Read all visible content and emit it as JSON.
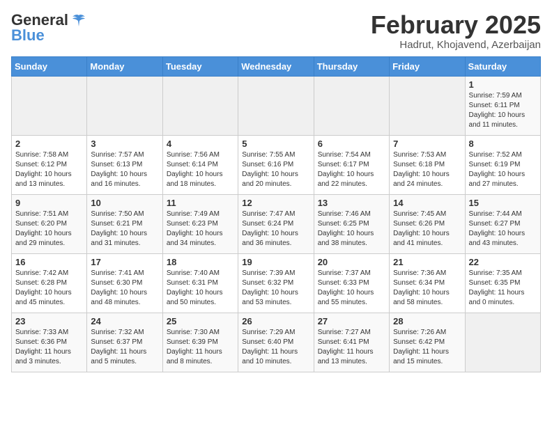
{
  "header": {
    "logo_general": "General",
    "logo_blue": "Blue",
    "month_title": "February 2025",
    "location": "Hadrut, Khojavend, Azerbaijan"
  },
  "weekdays": [
    "Sunday",
    "Monday",
    "Tuesday",
    "Wednesday",
    "Thursday",
    "Friday",
    "Saturday"
  ],
  "weeks": [
    [
      {
        "day": "",
        "info": ""
      },
      {
        "day": "",
        "info": ""
      },
      {
        "day": "",
        "info": ""
      },
      {
        "day": "",
        "info": ""
      },
      {
        "day": "",
        "info": ""
      },
      {
        "day": "",
        "info": ""
      },
      {
        "day": "1",
        "info": "Sunrise: 7:59 AM\nSunset: 6:11 PM\nDaylight: 10 hours\nand 11 minutes."
      }
    ],
    [
      {
        "day": "2",
        "info": "Sunrise: 7:58 AM\nSunset: 6:12 PM\nDaylight: 10 hours\nand 13 minutes."
      },
      {
        "day": "3",
        "info": "Sunrise: 7:57 AM\nSunset: 6:13 PM\nDaylight: 10 hours\nand 16 minutes."
      },
      {
        "day": "4",
        "info": "Sunrise: 7:56 AM\nSunset: 6:14 PM\nDaylight: 10 hours\nand 18 minutes."
      },
      {
        "day": "5",
        "info": "Sunrise: 7:55 AM\nSunset: 6:16 PM\nDaylight: 10 hours\nand 20 minutes."
      },
      {
        "day": "6",
        "info": "Sunrise: 7:54 AM\nSunset: 6:17 PM\nDaylight: 10 hours\nand 22 minutes."
      },
      {
        "day": "7",
        "info": "Sunrise: 7:53 AM\nSunset: 6:18 PM\nDaylight: 10 hours\nand 24 minutes."
      },
      {
        "day": "8",
        "info": "Sunrise: 7:52 AM\nSunset: 6:19 PM\nDaylight: 10 hours\nand 27 minutes."
      }
    ],
    [
      {
        "day": "9",
        "info": "Sunrise: 7:51 AM\nSunset: 6:20 PM\nDaylight: 10 hours\nand 29 minutes."
      },
      {
        "day": "10",
        "info": "Sunrise: 7:50 AM\nSunset: 6:21 PM\nDaylight: 10 hours\nand 31 minutes."
      },
      {
        "day": "11",
        "info": "Sunrise: 7:49 AM\nSunset: 6:23 PM\nDaylight: 10 hours\nand 34 minutes."
      },
      {
        "day": "12",
        "info": "Sunrise: 7:47 AM\nSunset: 6:24 PM\nDaylight: 10 hours\nand 36 minutes."
      },
      {
        "day": "13",
        "info": "Sunrise: 7:46 AM\nSunset: 6:25 PM\nDaylight: 10 hours\nand 38 minutes."
      },
      {
        "day": "14",
        "info": "Sunrise: 7:45 AM\nSunset: 6:26 PM\nDaylight: 10 hours\nand 41 minutes."
      },
      {
        "day": "15",
        "info": "Sunrise: 7:44 AM\nSunset: 6:27 PM\nDaylight: 10 hours\nand 43 minutes."
      }
    ],
    [
      {
        "day": "16",
        "info": "Sunrise: 7:42 AM\nSunset: 6:28 PM\nDaylight: 10 hours\nand 45 minutes."
      },
      {
        "day": "17",
        "info": "Sunrise: 7:41 AM\nSunset: 6:30 PM\nDaylight: 10 hours\nand 48 minutes."
      },
      {
        "day": "18",
        "info": "Sunrise: 7:40 AM\nSunset: 6:31 PM\nDaylight: 10 hours\nand 50 minutes."
      },
      {
        "day": "19",
        "info": "Sunrise: 7:39 AM\nSunset: 6:32 PM\nDaylight: 10 hours\nand 53 minutes."
      },
      {
        "day": "20",
        "info": "Sunrise: 7:37 AM\nSunset: 6:33 PM\nDaylight: 10 hours\nand 55 minutes."
      },
      {
        "day": "21",
        "info": "Sunrise: 7:36 AM\nSunset: 6:34 PM\nDaylight: 10 hours\nand 58 minutes."
      },
      {
        "day": "22",
        "info": "Sunrise: 7:35 AM\nSunset: 6:35 PM\nDaylight: 11 hours\nand 0 minutes."
      }
    ],
    [
      {
        "day": "23",
        "info": "Sunrise: 7:33 AM\nSunset: 6:36 PM\nDaylight: 11 hours\nand 3 minutes."
      },
      {
        "day": "24",
        "info": "Sunrise: 7:32 AM\nSunset: 6:37 PM\nDaylight: 11 hours\nand 5 minutes."
      },
      {
        "day": "25",
        "info": "Sunrise: 7:30 AM\nSunset: 6:39 PM\nDaylight: 11 hours\nand 8 minutes."
      },
      {
        "day": "26",
        "info": "Sunrise: 7:29 AM\nSunset: 6:40 PM\nDaylight: 11 hours\nand 10 minutes."
      },
      {
        "day": "27",
        "info": "Sunrise: 7:27 AM\nSunset: 6:41 PM\nDaylight: 11 hours\nand 13 minutes."
      },
      {
        "day": "28",
        "info": "Sunrise: 7:26 AM\nSunset: 6:42 PM\nDaylight: 11 hours\nand 15 minutes."
      },
      {
        "day": "",
        "info": ""
      }
    ]
  ]
}
